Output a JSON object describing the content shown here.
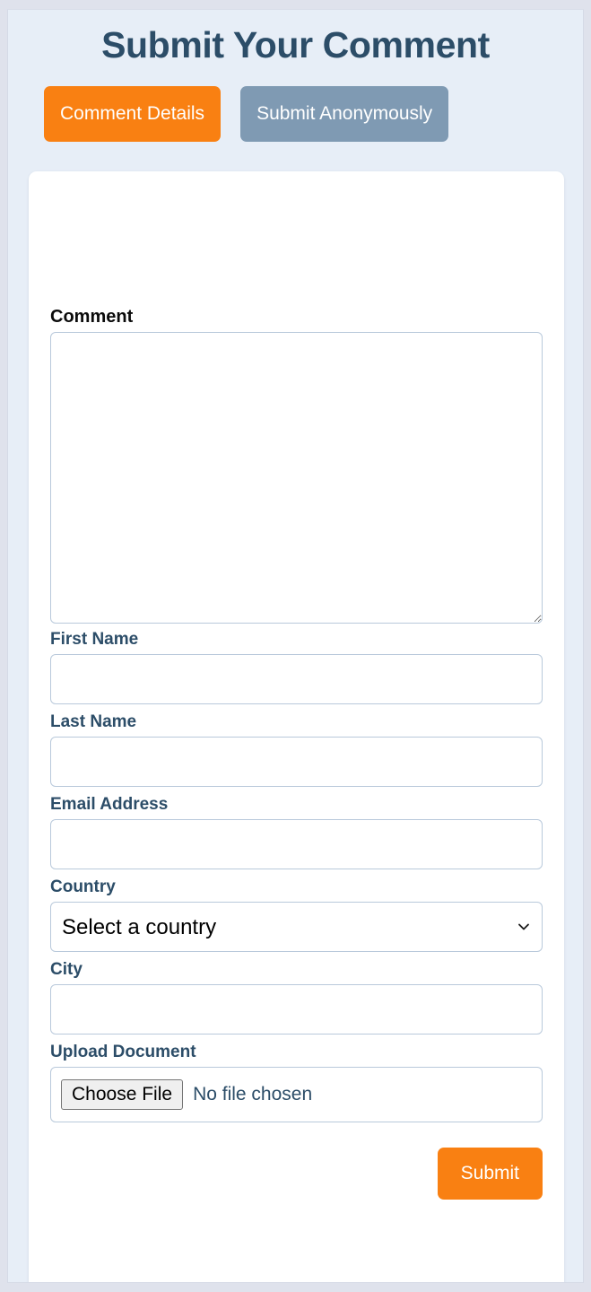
{
  "page": {
    "title": "Submit Your Comment",
    "background_color": "#dfe2ec",
    "panel_color": "#e7eef7",
    "accent_color": "#f98012",
    "secondary_color": "#7f9ab3",
    "label_color": "#2c4d68"
  },
  "tabs": [
    {
      "label": "Comment Details",
      "style": "primary",
      "selected": true
    },
    {
      "label": "Submit Anonymously",
      "style": "secondary",
      "selected": false
    }
  ],
  "form": {
    "fields": {
      "comment": {
        "label": "Comment",
        "value": "",
        "placeholder": ""
      },
      "first_name": {
        "label": "First Name",
        "value": "",
        "placeholder": ""
      },
      "last_name": {
        "label": "Last Name",
        "value": "",
        "placeholder": ""
      },
      "email": {
        "label": "Email Address",
        "value": "",
        "placeholder": ""
      },
      "country": {
        "label": "Country",
        "selected": "Select a country",
        "options": [
          "Select a country"
        ],
        "icon": "chevron-down-icon"
      },
      "city": {
        "label": "City",
        "value": "",
        "placeholder": ""
      },
      "upload": {
        "label": "Upload Document",
        "button_label": "Choose File",
        "status": "No file chosen"
      }
    },
    "submit": {
      "label": "Submit"
    }
  }
}
